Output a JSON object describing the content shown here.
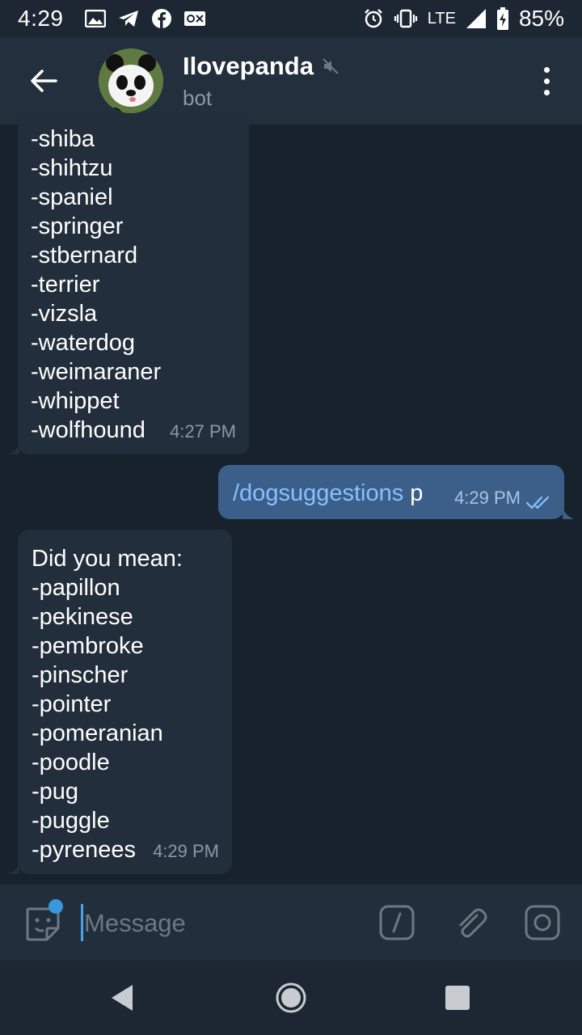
{
  "status_bar": {
    "time": "4:29",
    "network": "LTE",
    "battery": "85%",
    "left_icons": [
      "image-icon",
      "telegram-icon",
      "facebook-icon",
      "vpn-icon"
    ],
    "right_icons": [
      "alarm-icon",
      "vibrate-icon",
      "signal-icon",
      "battery-charging-icon"
    ]
  },
  "header": {
    "title": "Ilovepanda",
    "subtitle": "bot",
    "muted": true
  },
  "messages": [
    {
      "direction": "incoming",
      "lines": [
        "-shiba",
        "-shihtzu",
        "-spaniel",
        "-springer",
        "-stbernard",
        "-terrier",
        "-vizsla",
        "-waterdog",
        "-weimaraner",
        "-whippet",
        "-wolfhound"
      ],
      "time": "4:27 PM"
    },
    {
      "direction": "outgoing",
      "command": "/dogsuggestions",
      "argument": " p",
      "time": "4:29 PM",
      "status": "read"
    },
    {
      "direction": "incoming",
      "lines": [
        "Did you mean:",
        "-papillon",
        "-pekinese",
        "-pembroke",
        "-pinscher",
        "-pointer",
        "-pomeranian",
        "-poodle",
        "-pug",
        "-puggle",
        "-pyrenees"
      ],
      "time": "4:29 PM"
    }
  ],
  "input_bar": {
    "placeholder": "Message",
    "value": ""
  },
  "colors": {
    "background": "#18222d",
    "header": "#232f3d",
    "incoming_bubble": "#222e3b",
    "outgoing_bubble": "#3c5f8a",
    "link": "#87c1ff",
    "accent": "#3a96dd"
  }
}
